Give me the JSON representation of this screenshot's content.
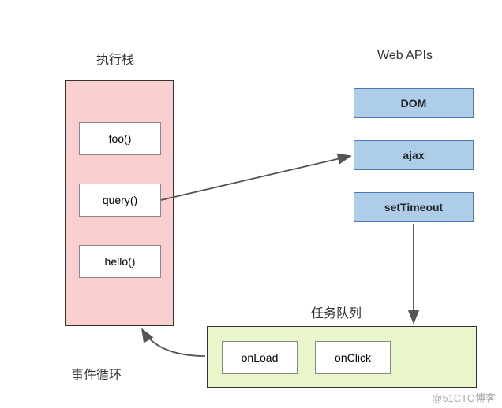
{
  "labels": {
    "stack_title": "执行栈",
    "webapis_title": "Web APIs",
    "queue_title": "任务队列",
    "event_loop": "事件循环"
  },
  "stack": {
    "items": [
      "foo()",
      "query()",
      "hello()"
    ]
  },
  "webapis": {
    "items": [
      "DOM",
      "ajax",
      "setTimeout"
    ]
  },
  "queue": {
    "items": [
      "onLoad",
      "onClick"
    ]
  },
  "watermark": "@51CTO博客"
}
